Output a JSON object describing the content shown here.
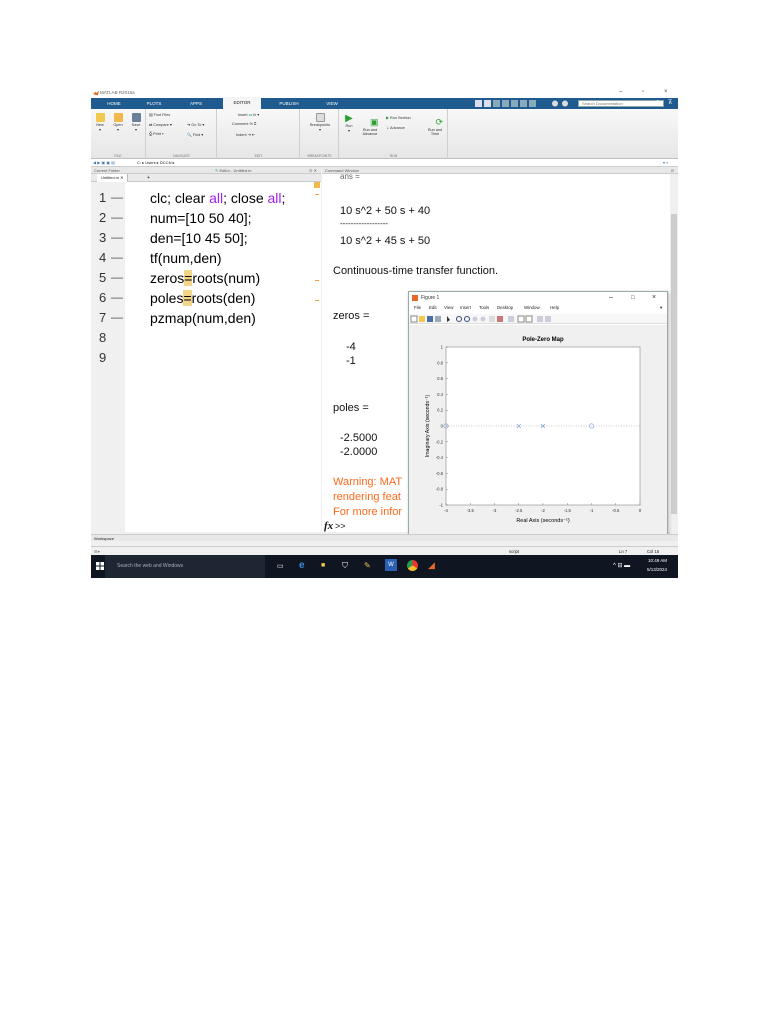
{
  "window": {
    "title": "MATLAB R2015a"
  },
  "ribbon_tabs": [
    {
      "label": "HOME",
      "active": false
    },
    {
      "label": "PLOTS",
      "active": false
    },
    {
      "label": "APPS",
      "active": false
    },
    {
      "label": "EDITOR",
      "active": true
    },
    {
      "label": "PUBLISH",
      "active": false
    },
    {
      "label": "VIEW",
      "active": false
    }
  ],
  "search": {
    "placeholder": "Search Documentation"
  },
  "ribbon": {
    "file": {
      "new": "New",
      "open": "Open",
      "save": "Save",
      "group": "FILE"
    },
    "navigate": {
      "find_files": "Find Files",
      "compare": "Compare",
      "print": "Print",
      "goto": "Go To",
      "find": "Find",
      "group": "NAVIGATE"
    },
    "edit": {
      "insert": "Insert",
      "comment": "Comment",
      "indent": "Indent",
      "group": "EDIT"
    },
    "breakpoints": {
      "label": "Breakpoints",
      "group": "BREAKPOINTS"
    },
    "run": {
      "run": "Run",
      "run_advance": "Run and\nAdvance",
      "run_section": "Run Section",
      "advance": "Advance",
      "run_time": "Run and\nTime",
      "group": "RUN"
    }
  },
  "address": {
    "path": "C: ▸ Users ▸ DCCN ▸"
  },
  "panels": {
    "current_folder": "Current Folder",
    "editor": "Editor - Untitled.m",
    "command_window": "Command Window",
    "workspace": "Workspace"
  },
  "editor": {
    "tab": "Untitled.m",
    "lines": [
      {
        "n": "1",
        "segments": [
          {
            "t": "clc; clear "
          },
          {
            "t": "all",
            "c": "kw"
          },
          {
            "t": "; close "
          },
          {
            "t": "all",
            "c": "kw"
          },
          {
            "t": ";"
          }
        ]
      },
      {
        "n": "2",
        "segments": [
          {
            "t": "num=[10 50 40];"
          }
        ]
      },
      {
        "n": "3",
        "segments": [
          {
            "t": "den=[10 45 50];"
          }
        ]
      },
      {
        "n": "4",
        "segments": [
          {
            "t": "tf(num,den)"
          }
        ]
      },
      {
        "n": "5",
        "segments": [
          {
            "t": "zeros"
          },
          {
            "t": "=",
            "c": "hl"
          },
          {
            "t": "roots(num)"
          }
        ]
      },
      {
        "n": "6",
        "segments": [
          {
            "t": "poles"
          },
          {
            "t": "=",
            "c": "hl"
          },
          {
            "t": "roots(den)"
          }
        ]
      },
      {
        "n": "7",
        "segments": [
          {
            "t": "pzmap(num,den)"
          }
        ]
      },
      {
        "n": "8",
        "segments": []
      },
      {
        "n": "9",
        "segments": []
      }
    ]
  },
  "command_window": {
    "numerator": "10 s^2 + 50 s + 40",
    "fraction_line": "------------------",
    "denominator": "10 s^2 + 45 s + 50",
    "tf_text": "Continuous-time transfer function.",
    "zeros_label": "zeros =",
    "zeros": [
      "-4",
      "-1"
    ],
    "poles_label": "poles =",
    "poles": [
      "-2.5000",
      "-2.0000"
    ],
    "warning_lines": [
      "Warning: MAT",
      "rendering feat",
      "For more infor"
    ],
    "prompt": ">>"
  },
  "figure": {
    "title": "Figure 1",
    "menu": [
      "File",
      "Edit",
      "View",
      "Insert",
      "Tools",
      "Desktop",
      "Window",
      "Help"
    ]
  },
  "chart_data": {
    "type": "scatter",
    "title": "Pole-Zero Map",
    "xlabel": "Real Axis (seconds⁻¹)",
    "ylabel": "Imaginary Axis (seconds⁻¹)",
    "xlim": [
      -4,
      0
    ],
    "ylim": [
      -1,
      1
    ],
    "xticks": [
      "-4",
      "-3.5",
      "-3",
      "-2.5",
      "-2",
      "-1.5",
      "-1",
      "-0.5",
      "0"
    ],
    "yticks": [
      "1",
      "0.8",
      "0.6",
      "0.4",
      "0.2",
      "0",
      "-0.2",
      "-0.4",
      "-0.6",
      "-0.8",
      "-1"
    ],
    "series": [
      {
        "name": "poles",
        "marker": "x",
        "points": [
          {
            "x": -2.5,
            "y": 0
          },
          {
            "x": -2.0,
            "y": 0
          }
        ]
      },
      {
        "name": "zeros",
        "marker": "o",
        "points": [
          {
            "x": -4,
            "y": 0
          },
          {
            "x": -1,
            "y": 0
          }
        ]
      }
    ],
    "marker_color": "#7f9fd0"
  },
  "status": {
    "mode": "script",
    "ln": "Ln 7",
    "col": "Col 15"
  },
  "taskbar": {
    "search": "Search the web and Windows",
    "time": "10:49 AM",
    "date": "5/13/2024"
  }
}
